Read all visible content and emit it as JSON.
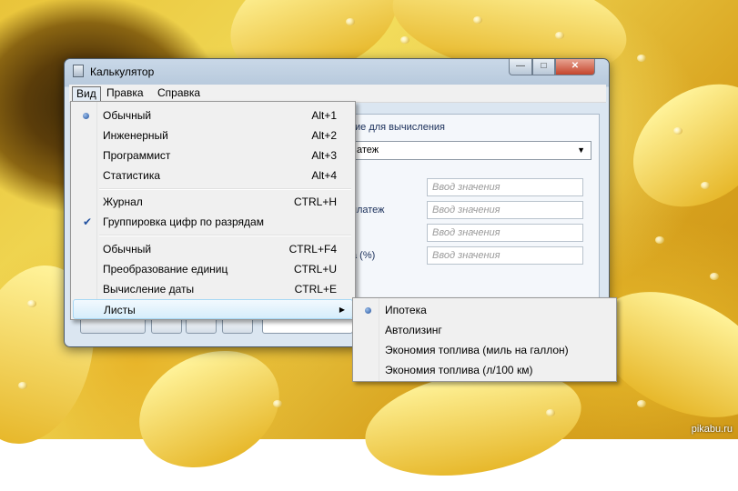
{
  "window": {
    "title": "Калькулятор"
  },
  "menubar": {
    "view": "Вид",
    "edit": "Правка",
    "help": "Справка"
  },
  "panel": {
    "title": "ие для вычисления",
    "select_value": "атеж",
    "rows": [
      {
        "label": "",
        "placeholder": "Ввод значения"
      },
      {
        "label": "платеж",
        "placeholder": "Ввод значения"
      },
      {
        "label": "",
        "placeholder": "Ввод значения"
      },
      {
        "label": "а (%)",
        "placeholder": "Ввод значения"
      }
    ]
  },
  "view_menu": {
    "items": [
      {
        "label": "Обычный",
        "shortcut": "Alt+1",
        "checked": "radio"
      },
      {
        "label": "Инженерный",
        "shortcut": "Alt+2"
      },
      {
        "label": "Программист",
        "shortcut": "Alt+3"
      },
      {
        "label": "Статистика",
        "shortcut": "Alt+4"
      },
      {
        "label": "Журнал",
        "shortcut": "CTRL+H"
      },
      {
        "label": "Группировка цифр по разрядам",
        "shortcut": "",
        "checked": "check"
      },
      {
        "label": "Обычный",
        "shortcut": "CTRL+F4"
      },
      {
        "label": "Преобразование единиц",
        "shortcut": "CTRL+U"
      },
      {
        "label": "Вычисление даты",
        "shortcut": "CTRL+E"
      },
      {
        "label": "Листы",
        "shortcut": "",
        "submenu": true,
        "highlighted": true
      }
    ]
  },
  "sheets_submenu": {
    "items": [
      {
        "label": "Ипотека",
        "checked": "radio"
      },
      {
        "label": "Автолизинг"
      },
      {
        "label": "Экономия топлива (миль на галлон)"
      },
      {
        "label": "Экономия топлива (л/100 км)"
      }
    ]
  },
  "watermark": "pikabu.ru",
  "icons": {
    "radio": "radio-dot-icon",
    "check": "checkmark-icon",
    "submenu": "submenu-arrow-icon",
    "dropdown": "dropdown-arrow-icon"
  },
  "colors": {
    "menu_highlight": "#d6edfb",
    "window_frame": "#b7c9dc",
    "wallpaper": "#e9c43a"
  }
}
